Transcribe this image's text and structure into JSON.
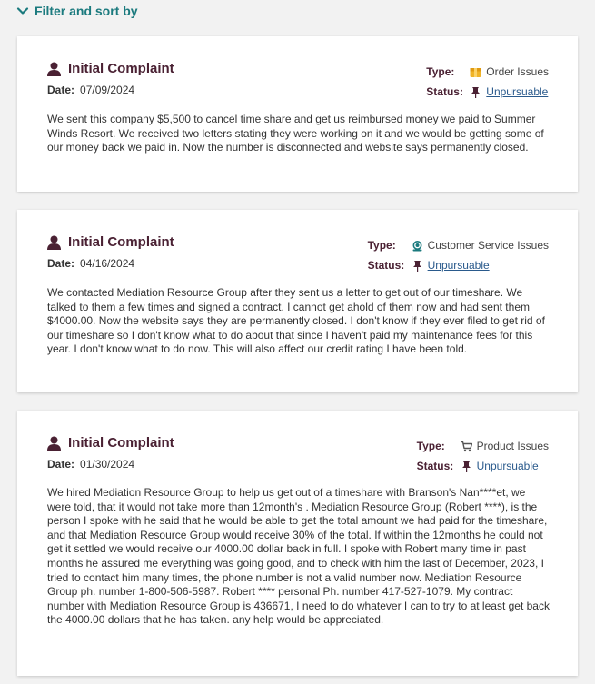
{
  "filter": {
    "label": "Filter and sort by"
  },
  "labels": {
    "type": "Type:",
    "status": "Status:",
    "date": "Date:"
  },
  "complaints": [
    {
      "title": "Initial Complaint",
      "date": "07/09/2024",
      "type": "Order Issues",
      "type_icon": "box-icon",
      "status": "Unpursuable",
      "text": "We sent this company $5,500 to cancel time share and get us reimbursed money we paid to Summer Winds Resort. We received two letters stating they were working on it and we would be getting some of our money back we paid in. Now the number is disconnected and website says permanently closed."
    },
    {
      "title": "Initial Complaint",
      "date": "04/16/2024",
      "type": "Customer Service Issues",
      "type_icon": "headset-icon",
      "status": "Unpursuable",
      "text": "We contacted Mediation Resource Group after they sent us a letter to get out of our timeshare. We talked to them a few times and signed a contract. I cannot get ahold of them now and had sent them $4000.00. Now the website says they are permanently closed. I don't know if they ever filed to get rid of our timeshare so I don't know what to do about that since I haven't paid my maintenance fees for this year. I don't know what to do now. This will also affect our credit rating I have been told."
    },
    {
      "title": "Initial Complaint",
      "date": "01/30/2024",
      "type": "Product Issues",
      "type_icon": "cart-icon",
      "status": "Unpursuable",
      "text": "We hired Mediation Resource Group to help us get out of a timeshare with Branson's Nan****et, we were told, that it would not take more than 12month's . Mediation Resource Group (Robert ****), is the person I spoke with he said that he would be able to get the total amount we had paid for the timeshare, and that Mediation Resource Group would receive 30% of the total. If within the 12months he could not get it settled we would receive our 4000.00 dollar back in full. I spoke with Robert many time in past months he assured me everything was going good, and to check with him the last of December, 2023, I tried to contact him many times, the phone number is not a valid number now. Mediation Resource Group ph. number 1-800-506-5987. Robert **** personal Ph. number 417-527-1079. My contract number with Mediation Resource Group is 436671, I need to do whatever I can to try to at least get back the 4000.00 dollars that he has taken. any help would be appreciated."
    }
  ]
}
